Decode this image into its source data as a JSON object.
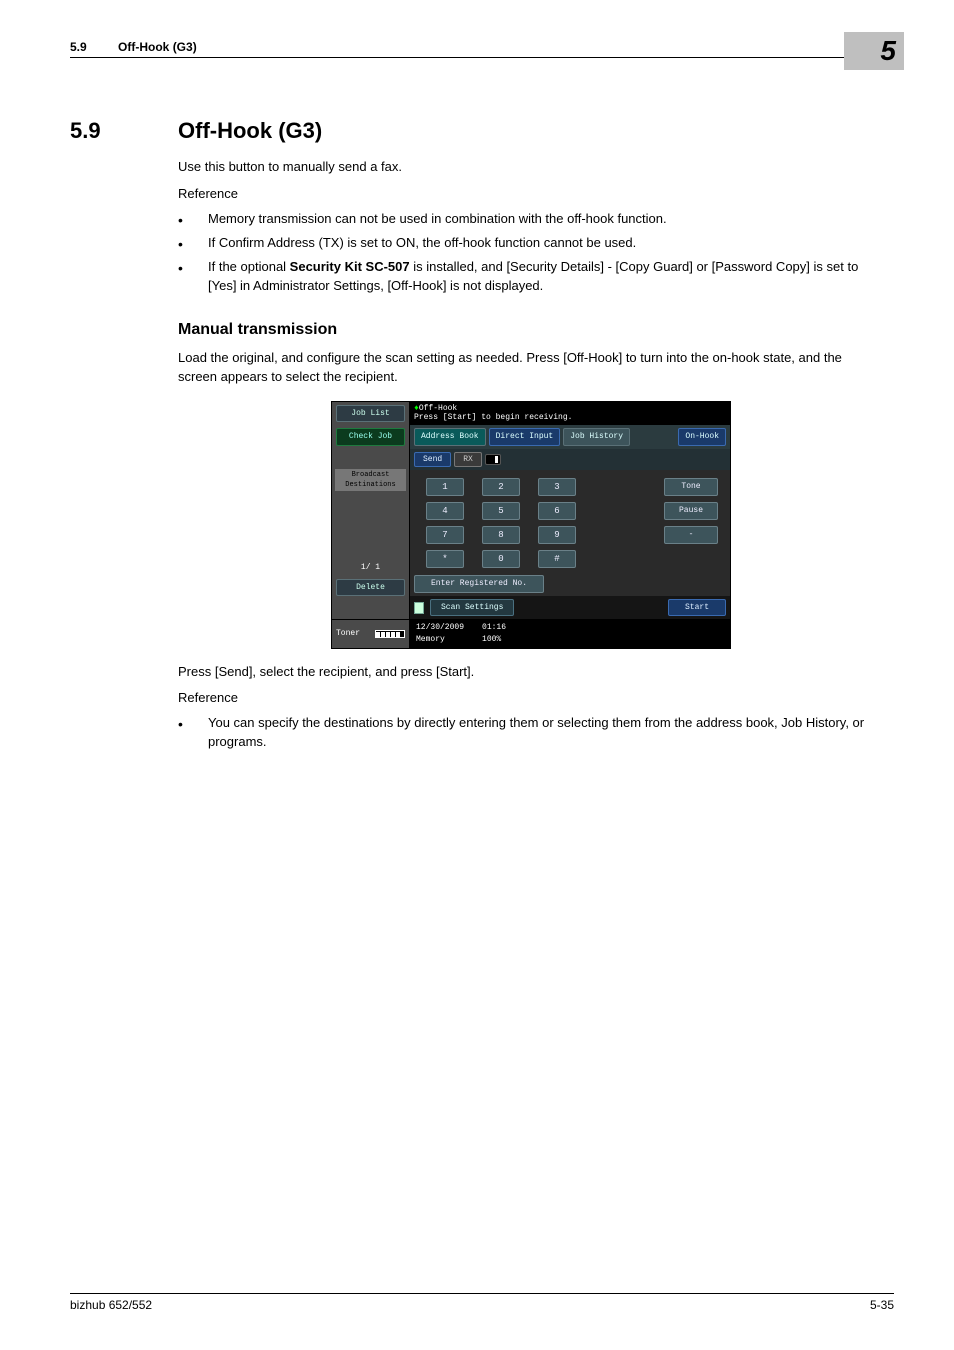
{
  "header": {
    "section_no": "5.9",
    "section_title": "Off-Hook (G3)",
    "chapter_badge": "5"
  },
  "heading": {
    "num": "5.9",
    "title": "Off-Hook (G3)"
  },
  "intro": "Use this button to manually send a fax.",
  "reference_label": "Reference",
  "bullets_a": [
    "Memory transmission can not be used in combination with the off-hook function.",
    "If Confirm Address (TX) is set to ON, the off-hook function cannot be used."
  ],
  "bullet_a3": {
    "pre": "If the optional ",
    "bold": "Security Kit SC-507",
    "post": " is installed, and [Security Details] - [Copy Guard] or [Password Copy] is set to [Yes] in Administrator Settings, [Off-Hook] is not displayed."
  },
  "h2": "Manual transmission",
  "p_manual": "Load the original, and configure the scan setting as needed. Press [Off-Hook] to turn into the on-hook state, and the screen appears to select the recipient.",
  "p_after": "Press [Send], select the recipient, and press [Start].",
  "bullets_b": [
    "You can specify the destinations by directly entering them or selecting them from the address book, Job History, or programs."
  ],
  "screenshot": {
    "side": {
      "job_list": "Job List",
      "check_job": "Check Job",
      "broadcast": "Broadcast Destinations",
      "page_ind": "1/  1",
      "delete": "Delete",
      "toner_label": "Toner"
    },
    "header_title": "Off-Hook",
    "header_msg": "Press [Start] to begin receiving.",
    "tabs": {
      "address_book": "Address Book",
      "direct_input": "Direct Input",
      "job_history": "Job History",
      "on_hook": "On-Hook"
    },
    "sendrx": {
      "send": "Send",
      "rx": "RX"
    },
    "keys": [
      "1",
      "2",
      "3",
      "4",
      "5",
      "6",
      "7",
      "8",
      "9",
      "*",
      "0",
      "#"
    ],
    "sidekeys": {
      "tone": "Tone",
      "pause": "Pause",
      "dash": "-"
    },
    "enter_reg": "Enter Registered No.",
    "scan_settings": "Scan Settings",
    "start": "Start",
    "status": {
      "date": "12/30/2009",
      "time": "01:16",
      "mem_label": "Memory",
      "mem_val": "100%"
    }
  },
  "footer": {
    "product": "bizhub 652/552",
    "page": "5-35"
  }
}
